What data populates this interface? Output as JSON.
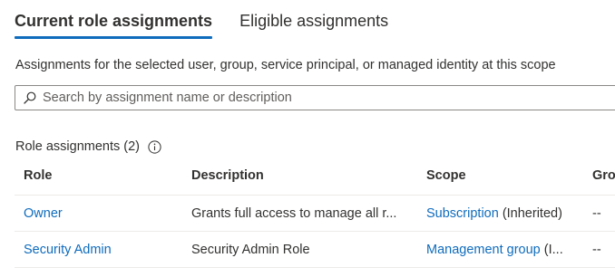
{
  "tabs": [
    {
      "label": "Current role assignments",
      "active": true
    },
    {
      "label": "Eligible assignments",
      "active": false
    }
  ],
  "description": "Assignments for the selected user, group, service principal, or managed identity at this scope",
  "search": {
    "placeholder": "Search by assignment name or description",
    "value": ""
  },
  "section": {
    "title": "Role assignments (2)",
    "icon": "info-icon"
  },
  "table": {
    "columns": {
      "role": "Role",
      "description": "Description",
      "scope": "Scope",
      "group": "Gro"
    },
    "rows": [
      {
        "role": "Owner",
        "description": "Grants full access to manage all r...",
        "scope_link": "Subscription",
        "scope_note": " (Inherited)",
        "group": "--"
      },
      {
        "role": "Security Admin",
        "description": "Security Admin Role",
        "scope_link": "Management group",
        "scope_note": " (I...",
        "group": "--"
      }
    ]
  },
  "colors": {
    "accent": "#0f6cbd",
    "text": "#323130",
    "border": "#8a8886"
  }
}
